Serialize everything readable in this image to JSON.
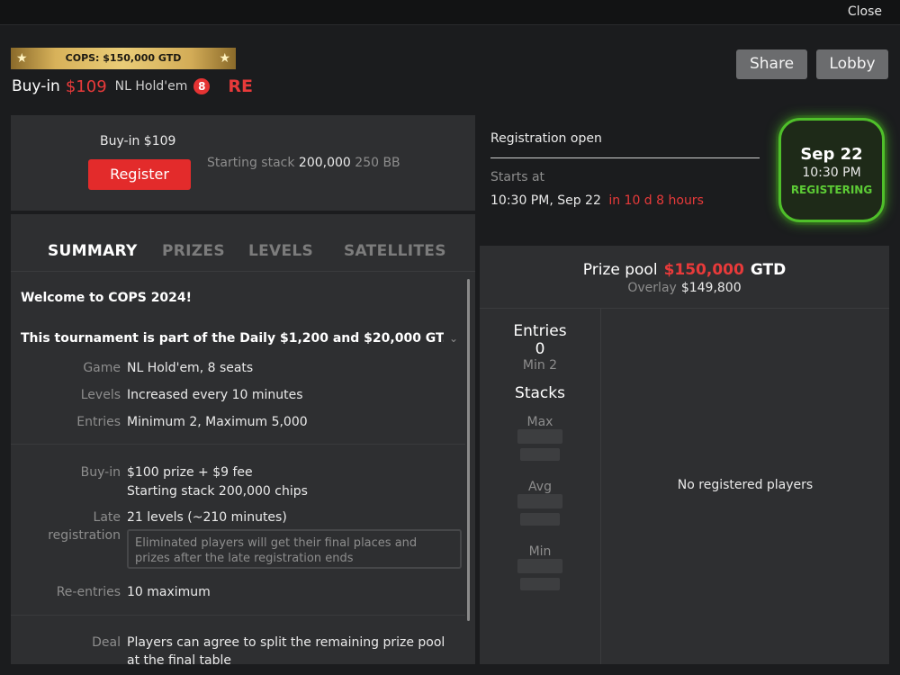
{
  "topbar": {
    "close_label": "Close"
  },
  "header": {
    "banner_text": "COPS: $150,000 GTD",
    "buyin_label": "Buy-in",
    "buyin_amount": "$109",
    "game": "NL Hold'em",
    "seats_badge": "8",
    "re_tag": "RE",
    "share_label": "Share",
    "lobby_label": "Lobby"
  },
  "registration": {
    "buyin_label": "Buy-in",
    "buyin_value": "$109",
    "register_label": "Register",
    "starting_stack_label": "Starting stack",
    "starting_stack_value": "200,000",
    "starting_stack_bb": "250 BB",
    "status_text": "Registration open",
    "starts_at_label": "Starts at",
    "starts_at_value": "10:30 PM, Sep 22",
    "starts_in": "in 10 d 8 hours"
  },
  "date_badge": {
    "day": "Sep 22",
    "time": "10:30 PM",
    "status": "REGISTERING"
  },
  "tabs": [
    "SUMMARY",
    "PRIZES",
    "LEVELS",
    "SATELLITES"
  ],
  "summary": {
    "welcome": "Welcome to COPS 2024!",
    "part_of": "This tournament is part of the Daily $1,200 and $20,000 GT...",
    "game_key": "Game",
    "game_val": "NL Hold'em, 8 seats",
    "levels_key": "Levels",
    "levels_val": "Increased every 10 minutes",
    "entries_key": "Entries",
    "entries_val": "Minimum 2, Maximum 5,000",
    "buyin_key": "Buy-in",
    "buyin_val1": "$100 prize + $9 fee",
    "buyin_val2": "Starting stack 200,000 chips",
    "late_key1": "Late",
    "late_key2": "registration",
    "late_val": "21 levels (~210 minutes)",
    "late_note": "Eliminated players will get their final places and prizes after the late registration ends",
    "reentries_key": "Re-entries",
    "reentries_val": "10 maximum",
    "deal_key": "Deal",
    "deal_val1": "Players can agree to split the remaining prize pool",
    "deal_val2": "at the final table"
  },
  "prize": {
    "label": "Prize pool",
    "value": "$150,000",
    "gtd": "GTD",
    "overlay_label": "Overlay",
    "overlay_value": "$149,800",
    "entries_title": "Entries",
    "entries_count": "0",
    "entries_min": "Min 2",
    "stacks_title": "Stacks",
    "max_label": "Max",
    "avg_label": "Avg",
    "min_label": "Min",
    "no_players": "No registered players"
  }
}
